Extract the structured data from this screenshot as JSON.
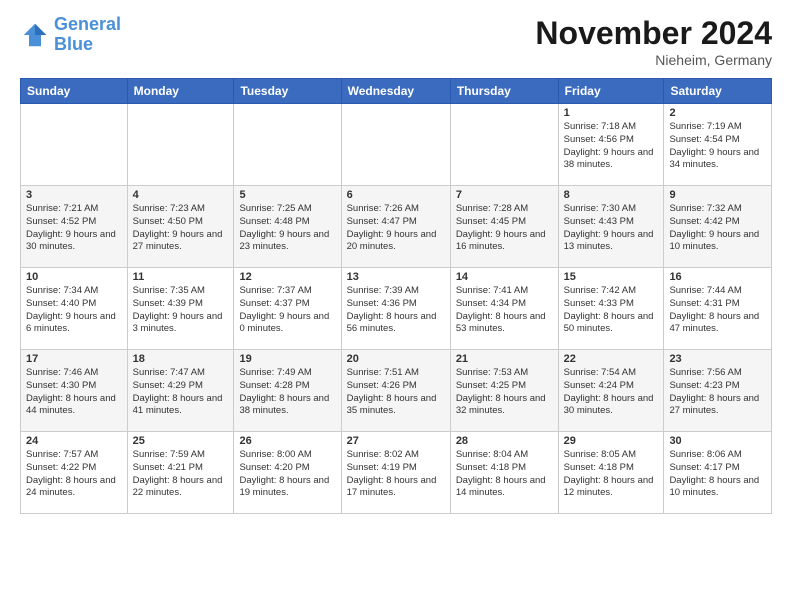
{
  "logo": {
    "line1": "General",
    "line2": "Blue"
  },
  "title": "November 2024",
  "subtitle": "Nieheim, Germany",
  "days_header": [
    "Sunday",
    "Monday",
    "Tuesday",
    "Wednesday",
    "Thursday",
    "Friday",
    "Saturday"
  ],
  "weeks": [
    [
      {
        "day": "",
        "info": ""
      },
      {
        "day": "",
        "info": ""
      },
      {
        "day": "",
        "info": ""
      },
      {
        "day": "",
        "info": ""
      },
      {
        "day": "",
        "info": ""
      },
      {
        "day": "1",
        "info": "Sunrise: 7:18 AM\nSunset: 4:56 PM\nDaylight: 9 hours\nand 38 minutes."
      },
      {
        "day": "2",
        "info": "Sunrise: 7:19 AM\nSunset: 4:54 PM\nDaylight: 9 hours\nand 34 minutes."
      }
    ],
    [
      {
        "day": "3",
        "info": "Sunrise: 7:21 AM\nSunset: 4:52 PM\nDaylight: 9 hours\nand 30 minutes."
      },
      {
        "day": "4",
        "info": "Sunrise: 7:23 AM\nSunset: 4:50 PM\nDaylight: 9 hours\nand 27 minutes."
      },
      {
        "day": "5",
        "info": "Sunrise: 7:25 AM\nSunset: 4:48 PM\nDaylight: 9 hours\nand 23 minutes."
      },
      {
        "day": "6",
        "info": "Sunrise: 7:26 AM\nSunset: 4:47 PM\nDaylight: 9 hours\nand 20 minutes."
      },
      {
        "day": "7",
        "info": "Sunrise: 7:28 AM\nSunset: 4:45 PM\nDaylight: 9 hours\nand 16 minutes."
      },
      {
        "day": "8",
        "info": "Sunrise: 7:30 AM\nSunset: 4:43 PM\nDaylight: 9 hours\nand 13 minutes."
      },
      {
        "day": "9",
        "info": "Sunrise: 7:32 AM\nSunset: 4:42 PM\nDaylight: 9 hours\nand 10 minutes."
      }
    ],
    [
      {
        "day": "10",
        "info": "Sunrise: 7:34 AM\nSunset: 4:40 PM\nDaylight: 9 hours\nand 6 minutes."
      },
      {
        "day": "11",
        "info": "Sunrise: 7:35 AM\nSunset: 4:39 PM\nDaylight: 9 hours\nand 3 minutes."
      },
      {
        "day": "12",
        "info": "Sunrise: 7:37 AM\nSunset: 4:37 PM\nDaylight: 9 hours\nand 0 minutes."
      },
      {
        "day": "13",
        "info": "Sunrise: 7:39 AM\nSunset: 4:36 PM\nDaylight: 8 hours\nand 56 minutes."
      },
      {
        "day": "14",
        "info": "Sunrise: 7:41 AM\nSunset: 4:34 PM\nDaylight: 8 hours\nand 53 minutes."
      },
      {
        "day": "15",
        "info": "Sunrise: 7:42 AM\nSunset: 4:33 PM\nDaylight: 8 hours\nand 50 minutes."
      },
      {
        "day": "16",
        "info": "Sunrise: 7:44 AM\nSunset: 4:31 PM\nDaylight: 8 hours\nand 47 minutes."
      }
    ],
    [
      {
        "day": "17",
        "info": "Sunrise: 7:46 AM\nSunset: 4:30 PM\nDaylight: 8 hours\nand 44 minutes."
      },
      {
        "day": "18",
        "info": "Sunrise: 7:47 AM\nSunset: 4:29 PM\nDaylight: 8 hours\nand 41 minutes."
      },
      {
        "day": "19",
        "info": "Sunrise: 7:49 AM\nSunset: 4:28 PM\nDaylight: 8 hours\nand 38 minutes."
      },
      {
        "day": "20",
        "info": "Sunrise: 7:51 AM\nSunset: 4:26 PM\nDaylight: 8 hours\nand 35 minutes."
      },
      {
        "day": "21",
        "info": "Sunrise: 7:53 AM\nSunset: 4:25 PM\nDaylight: 8 hours\nand 32 minutes."
      },
      {
        "day": "22",
        "info": "Sunrise: 7:54 AM\nSunset: 4:24 PM\nDaylight: 8 hours\nand 30 minutes."
      },
      {
        "day": "23",
        "info": "Sunrise: 7:56 AM\nSunset: 4:23 PM\nDaylight: 8 hours\nand 27 minutes."
      }
    ],
    [
      {
        "day": "24",
        "info": "Sunrise: 7:57 AM\nSunset: 4:22 PM\nDaylight: 8 hours\nand 24 minutes."
      },
      {
        "day": "25",
        "info": "Sunrise: 7:59 AM\nSunset: 4:21 PM\nDaylight: 8 hours\nand 22 minutes."
      },
      {
        "day": "26",
        "info": "Sunrise: 8:00 AM\nSunset: 4:20 PM\nDaylight: 8 hours\nand 19 minutes."
      },
      {
        "day": "27",
        "info": "Sunrise: 8:02 AM\nSunset: 4:19 PM\nDaylight: 8 hours\nand 17 minutes."
      },
      {
        "day": "28",
        "info": "Sunrise: 8:04 AM\nSunset: 4:18 PM\nDaylight: 8 hours\nand 14 minutes."
      },
      {
        "day": "29",
        "info": "Sunrise: 8:05 AM\nSunset: 4:18 PM\nDaylight: 8 hours\nand 12 minutes."
      },
      {
        "day": "30",
        "info": "Sunrise: 8:06 AM\nSunset: 4:17 PM\nDaylight: 8 hours\nand 10 minutes."
      }
    ]
  ]
}
